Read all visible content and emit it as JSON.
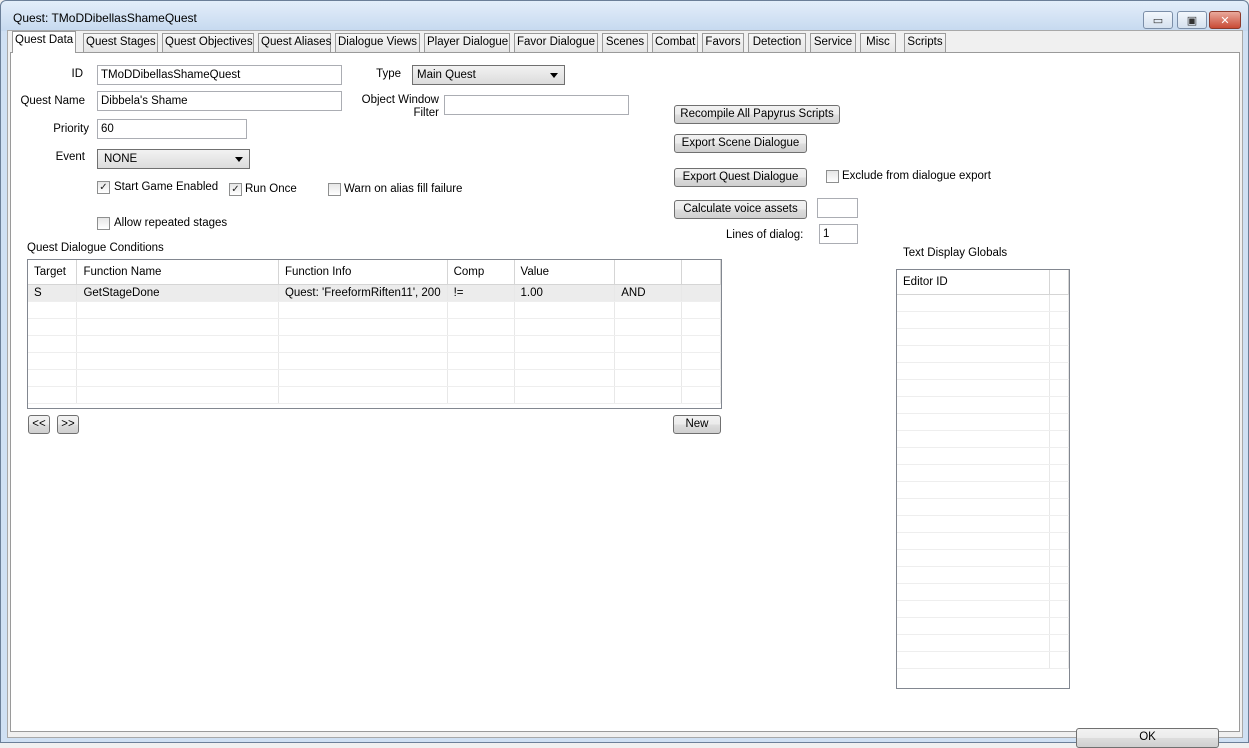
{
  "window": {
    "title": "Quest: TMoDDibellasShameQuest",
    "buttons": {
      "minimize": "▭",
      "maximize": "▣",
      "close": "✕"
    }
  },
  "tabs": [
    {
      "label": "Quest Data",
      "active": true
    },
    {
      "label": "Quest Stages"
    },
    {
      "label": "Quest Objectives"
    },
    {
      "label": "Quest Aliases"
    },
    {
      "label": "Dialogue Views"
    },
    {
      "label": "Player Dialogue"
    },
    {
      "label": "Favor Dialogue"
    },
    {
      "label": "Scenes"
    },
    {
      "label": "Combat"
    },
    {
      "label": "Favors"
    },
    {
      "label": "Detection"
    },
    {
      "label": "Service"
    },
    {
      "label": "Misc"
    },
    {
      "label": "Scripts"
    }
  ],
  "form": {
    "id_label": "ID",
    "id_value": "TMoDDibellasShameQuest",
    "quest_name_label": "Quest Name",
    "quest_name_value": "Dibbela's Shame",
    "priority_label": "Priority",
    "priority_value": "60",
    "event_label": "Event",
    "event_value": "NONE",
    "type_label": "Type",
    "type_value": "Main Quest",
    "object_window_filter_label_1": "Object Window",
    "object_window_filter_label_2": "Filter",
    "object_window_filter_value": "",
    "start_game_enabled": {
      "label": "Start Game Enabled",
      "checked": true
    },
    "run_once": {
      "label": "Run Once",
      "checked": true
    },
    "warn_alias": {
      "label": "Warn on alias fill failure",
      "checked": false
    },
    "allow_repeated": {
      "label": "Allow repeated stages",
      "checked": false
    }
  },
  "actions": {
    "recompile": "Recompile All Papyrus Scripts",
    "export_scene": "Export Scene Dialogue",
    "export_quest": "Export Quest Dialogue",
    "exclude_export": {
      "label": "Exclude from dialogue export",
      "checked": false
    },
    "calc_voice": "Calculate voice assets",
    "calc_voice_value": "",
    "lines_label": "Lines of dialog:",
    "lines_value": "1"
  },
  "conditions": {
    "title": "Quest Dialogue Conditions",
    "columns": [
      "Target",
      "Function Name",
      "Function Info",
      "Comp",
      "Value",
      ""
    ],
    "rows": [
      [
        "S",
        "GetStageDone",
        "Quest: 'FreeformRiften11', 200",
        "!=",
        "1.00",
        "AND"
      ]
    ],
    "prev_button": "<<",
    "next_button": ">>",
    "new_button": "New"
  },
  "globals": {
    "title": "Text Display Globals",
    "columns": [
      "Editor ID"
    ]
  },
  "ok_button": "OK"
}
